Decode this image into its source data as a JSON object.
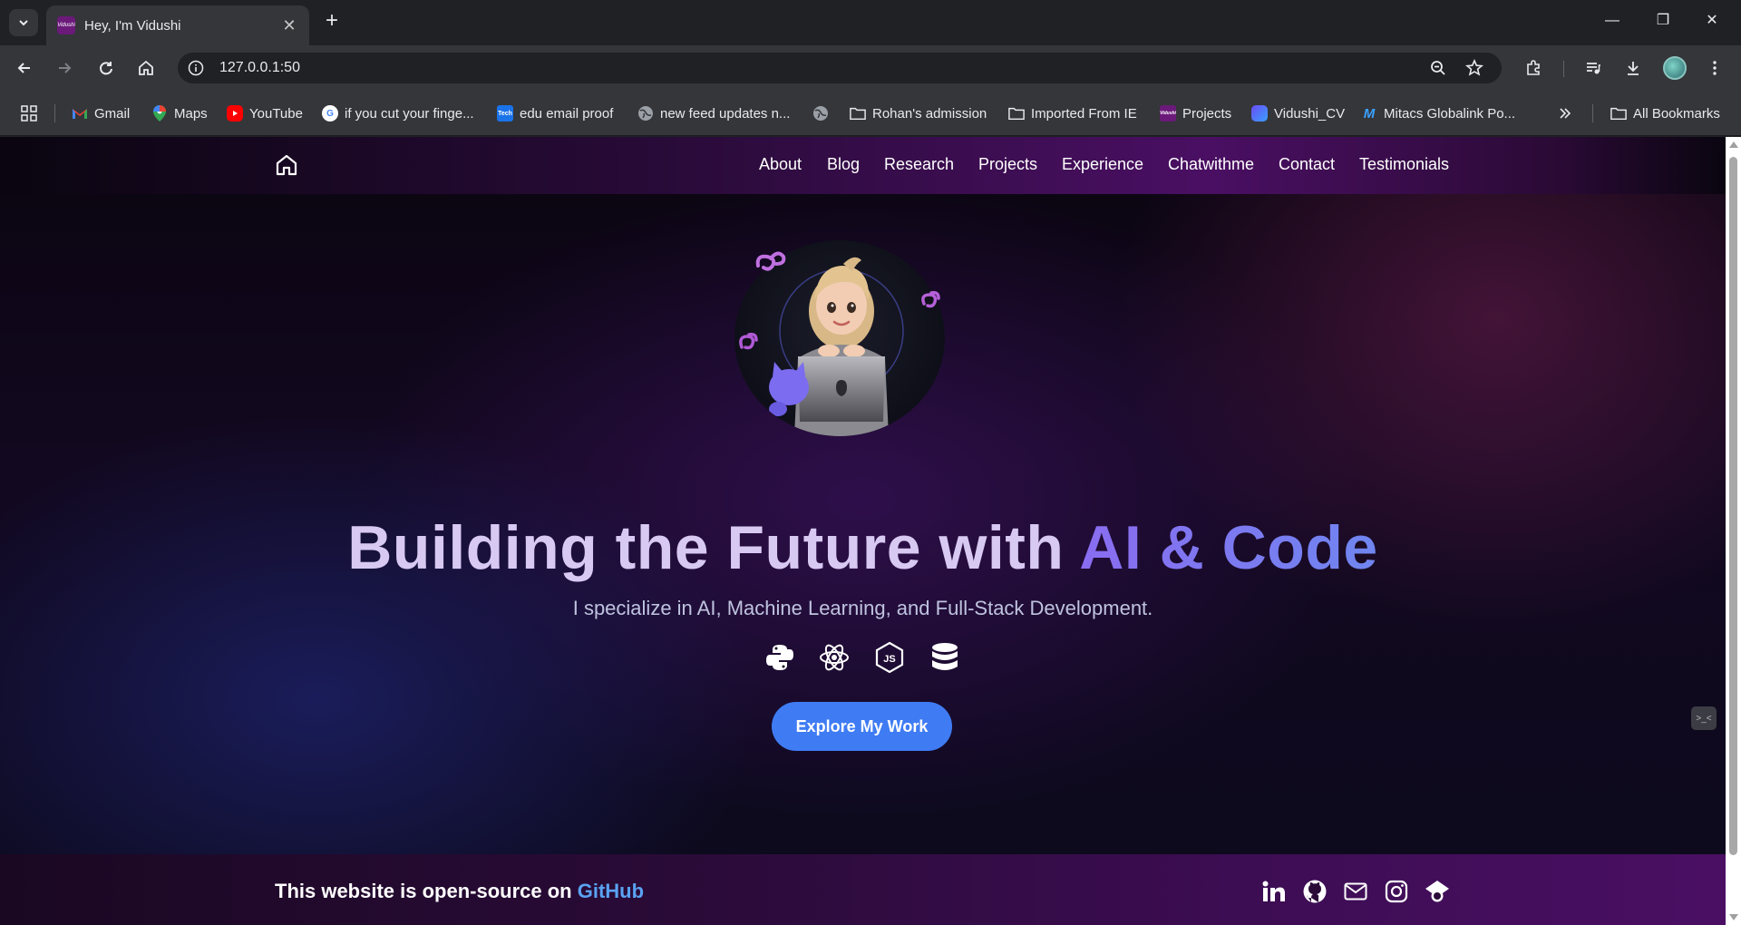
{
  "browser": {
    "tab": {
      "title": "Hey, I'm Vidushi",
      "favicon_text": "Vidushi"
    },
    "address": {
      "url": "127.0.0.1:50"
    },
    "bookmarks": [
      {
        "label": "Gmail",
        "icon": "gmail-icon"
      },
      {
        "label": "Maps",
        "icon": "maps-icon"
      },
      {
        "label": "YouTube",
        "icon": "youtube-icon"
      },
      {
        "label": "if you cut your finge...",
        "icon": "google-icon"
      },
      {
        "label": "edu email proof",
        "icon": "tech-icon"
      },
      {
        "label": "new feed updates n...",
        "icon": "globe-icon"
      },
      {
        "label": "",
        "icon": "globe-icon"
      },
      {
        "label": "Rohan's admission",
        "icon": "folder-icon"
      },
      {
        "label": "Imported From IE",
        "icon": "folder-icon"
      },
      {
        "label": "Projects",
        "icon": "vidushi-favicon"
      },
      {
        "label": "Vidushi_CV",
        "icon": "cv-icon"
      },
      {
        "label": "Mitacs Globalink Po...",
        "icon": "mitacs-icon"
      }
    ],
    "all_bookmarks_label": "All Bookmarks",
    "colors": {
      "chrome_dark": "#202124",
      "chrome_toolbar": "#35363a"
    }
  },
  "site": {
    "nav": {
      "links": [
        "About",
        "Blog",
        "Research",
        "Projects",
        "Experience",
        "Chatwithme",
        "Contact",
        "Testimonials"
      ]
    },
    "hero": {
      "title_main": "Building the Future with ",
      "title_accent": "AI & Code",
      "subtitle": "I specialize in AI, Machine Learning, and Full-Stack Development.",
      "skills": [
        "python-icon",
        "react-icon",
        "nodejs-icon",
        "database-icon"
      ],
      "cta_label": "Explore My Work",
      "side_widget": ">_<"
    },
    "footer": {
      "text": "This website is open-source on ",
      "link": "GitHub",
      "social": [
        "linkedin-icon",
        "github-icon",
        "mail-icon",
        "instagram-icon",
        "scholar-icon"
      ]
    },
    "colors": {
      "accent": "#3f7cf4",
      "title": "#d8c9f2",
      "gradient_purple": "#4a0f63",
      "link": "#5aa2f2"
    }
  }
}
